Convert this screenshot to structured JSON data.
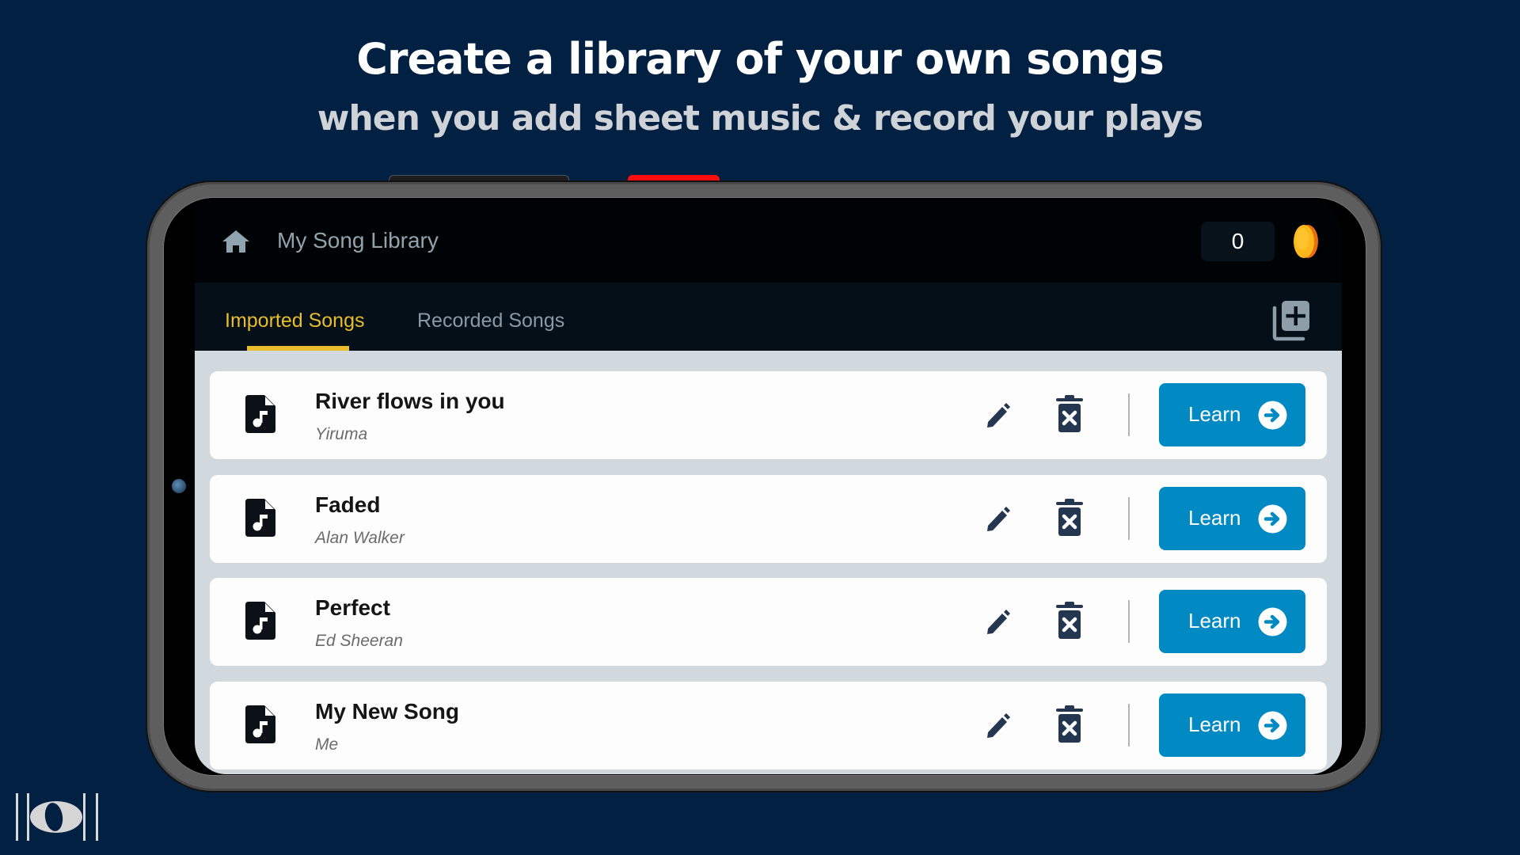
{
  "promo": {
    "headline": "Create a library of your own songs",
    "subheadline": "when you add sheet music & record your plays"
  },
  "app": {
    "title": "My Song Library",
    "home_icon": "home-icon",
    "coin_count": "0",
    "coin_icon": "coin-icon",
    "add_icon": "library-add-icon"
  },
  "tabs": [
    {
      "label": "Imported Songs",
      "active": true
    },
    {
      "label": "Recorded Songs",
      "active": false
    }
  ],
  "songs": [
    {
      "title": "River flows in you",
      "artist": "Yiruma",
      "action": "Learn"
    },
    {
      "title": "Faded",
      "artist": "Alan Walker",
      "action": "Learn"
    },
    {
      "title": "Perfect",
      "artist": "Ed Sheeran",
      "action": "Learn"
    },
    {
      "title": "My New Song",
      "artist": "Me",
      "action": "Learn"
    }
  ],
  "colors": {
    "background": "#022041",
    "accent_tab": "#e9be2c",
    "learn_button": "#0089c3",
    "icon_dark": "#253750",
    "coin": "#f7b21b"
  }
}
